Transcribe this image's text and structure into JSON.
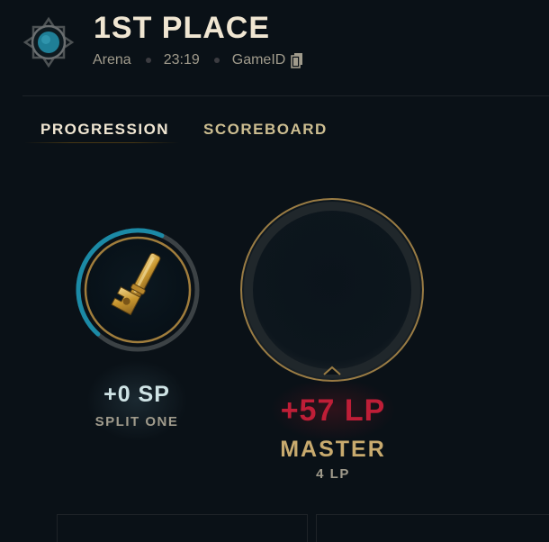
{
  "header": {
    "title": "1ST PLACE",
    "mode": "Arena",
    "duration": "23:19",
    "game_id_label": "GameID",
    "emblem_icon": "arena-emblem-icon",
    "copy_icon": "copy-icon"
  },
  "tabs": [
    {
      "label": "PROGRESSION",
      "active": true
    },
    {
      "label": "SCOREBOARD",
      "active": false
    }
  ],
  "split": {
    "points_change": "+0 SP",
    "name": "SPLIT ONE",
    "icon": "key-icon",
    "progress_fraction": 0.45
  },
  "rank": {
    "lp_change": "+57 LP",
    "tier": "MASTER",
    "current_lp": "4 LP"
  },
  "colors": {
    "background": "#0a1117",
    "gold": "#c8aa6e",
    "title": "#f0e6d2",
    "lp_change": "#be1e37",
    "progress_blue": "#1b8aa6",
    "text_muted": "#a09b8c"
  }
}
